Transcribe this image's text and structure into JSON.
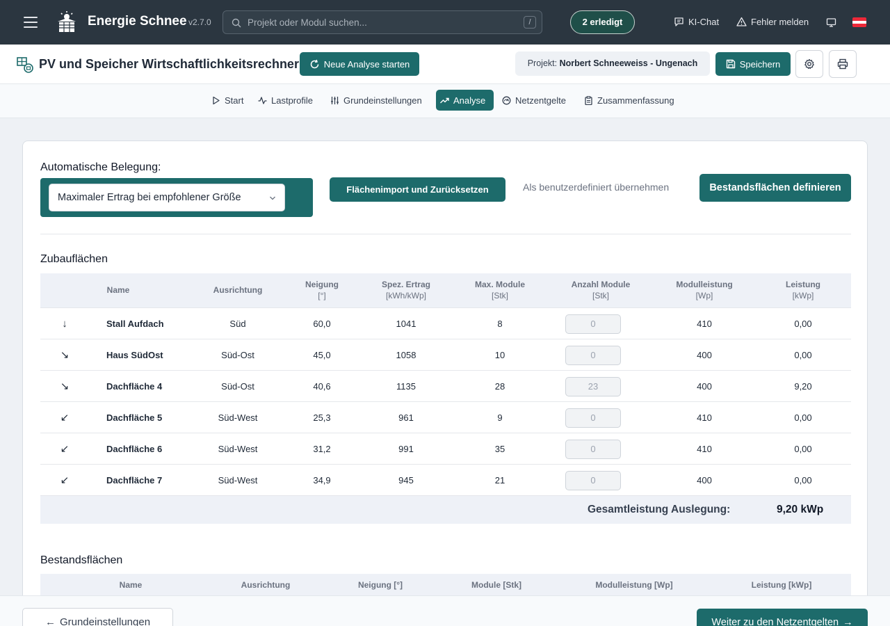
{
  "topbar": {
    "brand": "Energie Schnee",
    "version": "v2.7.0",
    "search_placeholder": "Projekt oder Modul suchen...",
    "search_shortcut": "/",
    "done_badge": "2 erledigt",
    "ai_chat": "KI-Chat",
    "report_error": "Fehler melden",
    "flag_colors": [
      "#ed2939",
      "#ffffff",
      "#ed2939"
    ]
  },
  "titlebar": {
    "title": "PV und Speicher Wirtschaftlichkeitsrechner",
    "new_analysis": "Neue Analyse starten",
    "project_label": "Projekt:",
    "project_name": "Norbert Schneeweiss - Ungenach",
    "save": "Speichern"
  },
  "tabs": [
    {
      "label": "Start",
      "icon": "play-icon"
    },
    {
      "label": "Lastprofile",
      "icon": "activity-icon"
    },
    {
      "label": "Grundeinstellungen",
      "icon": "sliders-icon"
    },
    {
      "label": "Analyse",
      "icon": "trending-up-icon",
      "active": true
    },
    {
      "label": "Netzentgelte",
      "icon": "gauge-icon"
    },
    {
      "label": "Zusammenfassung",
      "icon": "clipboard-icon"
    }
  ],
  "belegung": {
    "label": "Automatische Belegung:",
    "selected": "Maximaler Ertrag bei empfohlener Größe",
    "import_reset": "Flächenimport und Zurücksetzen",
    "adopt_custom": "Als benutzerdefiniert übernehmen",
    "define_existing": "Bestandsflächen definieren"
  },
  "zubau": {
    "title": "Zubauflächen",
    "headers": {
      "name": "Name",
      "ausrichtung": "Ausrichtung",
      "neigung": "Neigung",
      "neigung_unit": "[°]",
      "ertrag": "Spez. Ertrag",
      "ertrag_unit": "[kWh/kWp]",
      "max_module": "Max. Module",
      "max_module_unit": "[Stk]",
      "anzahl": "Anzahl Module",
      "anzahl_unit": "[Stk]",
      "modulleistung": "Modulleistung",
      "modulleistung_unit": "[Wp]",
      "leistung": "Leistung",
      "leistung_unit": "[kWp]"
    },
    "rows": [
      {
        "arrow": "↓",
        "name": "Stall Aufdach",
        "ausrichtung": "Süd",
        "neigung": "60,0",
        "ertrag": "1041",
        "max": "8",
        "anzahl": "0",
        "modulleistung": "410",
        "leistung": "0,00"
      },
      {
        "arrow": "↘",
        "name": "Haus SüdOst",
        "ausrichtung": "Süd-Ost",
        "neigung": "45,0",
        "ertrag": "1058",
        "max": "10",
        "anzahl": "0",
        "modulleistung": "400",
        "leistung": "0,00"
      },
      {
        "arrow": "↘",
        "name": "Dachfläche 4",
        "ausrichtung": "Süd-Ost",
        "neigung": "40,6",
        "ertrag": "1135",
        "max": "28",
        "anzahl": "23",
        "modulleistung": "400",
        "leistung": "9,20"
      },
      {
        "arrow": "↙",
        "name": "Dachfläche 5",
        "ausrichtung": "Süd-West",
        "neigung": "25,3",
        "ertrag": "961",
        "max": "9",
        "anzahl": "0",
        "modulleistung": "410",
        "leistung": "0,00"
      },
      {
        "arrow": "↙",
        "name": "Dachfläche 6",
        "ausrichtung": "Süd-West",
        "neigung": "31,2",
        "ertrag": "991",
        "max": "35",
        "anzahl": "0",
        "modulleistung": "410",
        "leistung": "0,00"
      },
      {
        "arrow": "↙",
        "name": "Dachfläche 7",
        "ausrichtung": "Süd-West",
        "neigung": "34,9",
        "ertrag": "945",
        "max": "21",
        "anzahl": "0",
        "modulleistung": "400",
        "leistung": "0,00"
      }
    ],
    "total_label": "Gesamtleistung Auslegung:",
    "total_value": "9,20 kWp"
  },
  "bestand": {
    "title": "Bestandsflächen",
    "headers": {
      "name": "Name",
      "ausrichtung": "Ausrichtung",
      "neigung": "Neigung [°]",
      "module": "Module [Stk]",
      "modulleistung": "Modulleistung [Wp]",
      "leistung": "Leistung [kWp]"
    }
  },
  "footer": {
    "back": "Grundeinstellungen",
    "next": "Weiter zu den Netzentgelten"
  }
}
